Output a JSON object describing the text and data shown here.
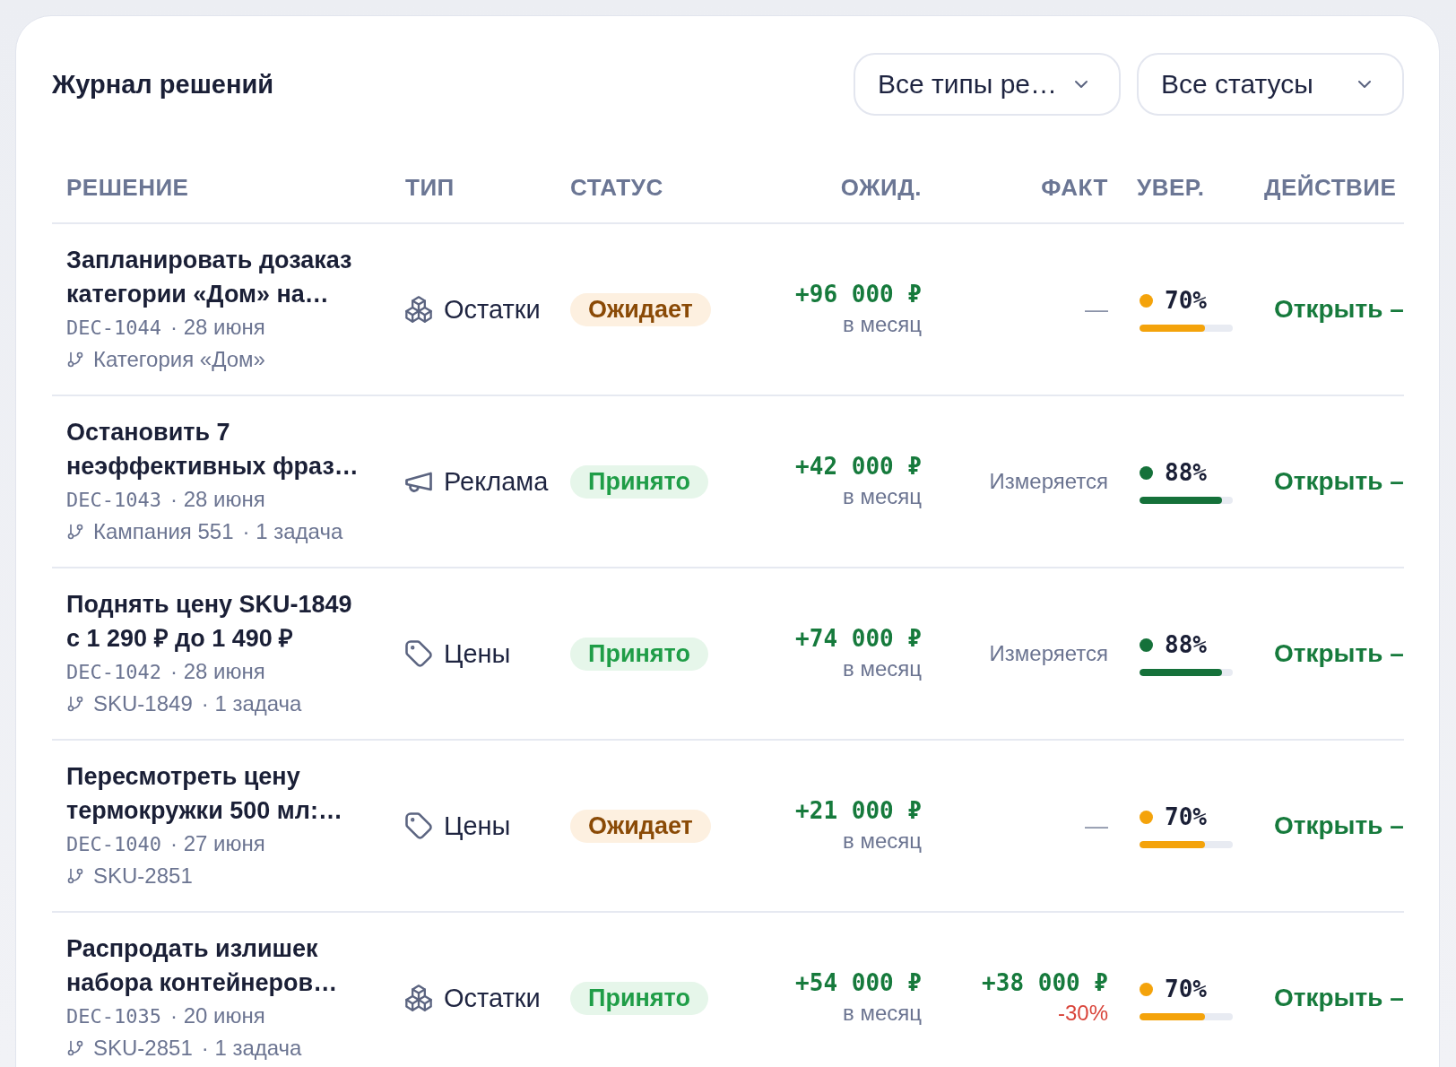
{
  "header": {
    "title": "Журнал решений",
    "filters": [
      {
        "label": "Все типы ре…"
      },
      {
        "label": "Все статусы"
      }
    ]
  },
  "table": {
    "columns": [
      "РЕШЕНИЕ",
      "ТИП",
      "СТАТУС",
      "ОЖИД.",
      "ФАКТ",
      "УВЕР.",
      "ДЕЙСТВИЕ"
    ],
    "rows": [
      {
        "title": "Запланировать дозаказ категории «Дом» на…",
        "id": "DEC-1044",
        "date": "· 28 июня",
        "link": "Категория «Дом»",
        "type": {
          "kind": "stock",
          "label": "Остатки"
        },
        "status": {
          "kind": "pending",
          "label": "Ожидает"
        },
        "expected": {
          "value": "+96 000 ₽",
          "period": "в месяц"
        },
        "fact": {
          "kind": "empty",
          "text": "—"
        },
        "confidence": {
          "label": "70%",
          "level": 0.7,
          "color": "#f4a30b"
        },
        "action": "Открыть –"
      },
      {
        "title": "Остановить 7 неэффективных фраз…",
        "id": "DEC-1043",
        "date": "· 28 июня",
        "link": "Кампания 551",
        "tasks": "· 1 задача",
        "type": {
          "kind": "ads",
          "label": "Реклама"
        },
        "status": {
          "kind": "accepted",
          "label": "Принято"
        },
        "expected": {
          "value": "+42 000 ₽",
          "period": "в месяц"
        },
        "fact": {
          "kind": "status",
          "text": "Измеряется"
        },
        "confidence": {
          "label": "88%",
          "level": 0.88,
          "color": "#15713a"
        },
        "action": "Открыть –"
      },
      {
        "title": "Поднять цену SKU-1849 с 1 290 ₽ до 1 490 ₽",
        "id": "DEC-1042",
        "date": "· 28 июня",
        "link": "SKU-1849",
        "tasks": "· 1 задача",
        "type": {
          "kind": "price",
          "label": "Цены"
        },
        "status": {
          "kind": "accepted",
          "label": "Принято"
        },
        "expected": {
          "value": "+74 000 ₽",
          "period": "в месяц"
        },
        "fact": {
          "kind": "status",
          "text": "Измеряется"
        },
        "confidence": {
          "label": "88%",
          "level": 0.88,
          "color": "#15713a"
        },
        "action": "Открыть –"
      },
      {
        "title": "Пересмотреть цену термокружки 500 мл:…",
        "id": "DEC-1040",
        "date": "· 27 июня",
        "link": "SKU-2851",
        "type": {
          "kind": "price",
          "label": "Цены"
        },
        "status": {
          "kind": "pending",
          "label": "Ожидает"
        },
        "expected": {
          "value": "+21 000 ₽",
          "period": "в месяц"
        },
        "fact": {
          "kind": "empty",
          "text": "—"
        },
        "confidence": {
          "label": "70%",
          "level": 0.7,
          "color": "#f4a30b"
        },
        "action": "Открыть –"
      },
      {
        "title": "Распродать излишек набора контейнеров…",
        "id": "DEC-1035",
        "date": "· 20 июня",
        "link": "SKU-2851",
        "tasks": "· 1 задача",
        "type": {
          "kind": "stock",
          "label": "Остатки"
        },
        "status": {
          "kind": "accepted",
          "label": "Принято"
        },
        "expected": {
          "value": "+54 000 ₽",
          "period": "в месяц"
        },
        "fact": {
          "kind": "value",
          "value": "+38 000 ₽",
          "delta": "-30%"
        },
        "confidence": {
          "label": "70%",
          "level": 0.7,
          "color": "#f4a30b"
        },
        "action": "Открыть –"
      }
    ]
  }
}
